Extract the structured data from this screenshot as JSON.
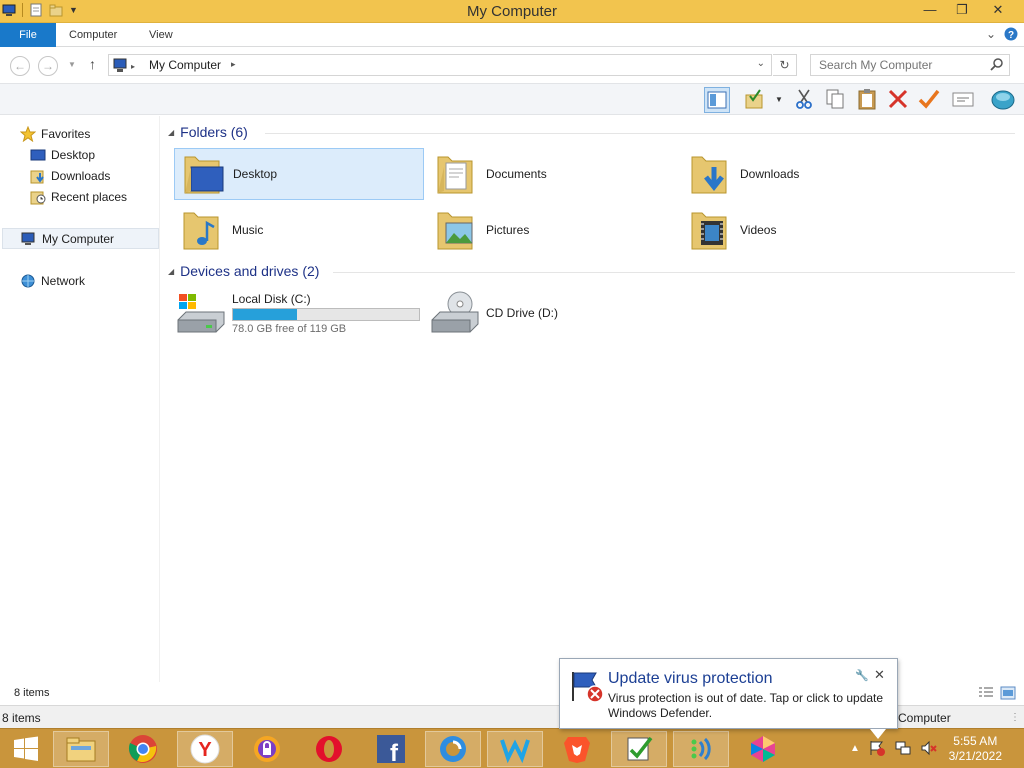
{
  "window": {
    "title": "My Computer"
  },
  "ribbon": {
    "tabs": [
      "File",
      "Computer",
      "View"
    ]
  },
  "address": {
    "path": "My Computer",
    "search_placeholder": "Search My Computer"
  },
  "sidebar": {
    "favorites_label": "Favorites",
    "favorites": [
      "Desktop",
      "Downloads",
      "Recent places"
    ],
    "computer_label": "My Computer",
    "network_label": "Network"
  },
  "folders": {
    "header": "Folders (6)",
    "items": [
      "Desktop",
      "Documents",
      "Downloads",
      "Music",
      "Pictures",
      "Videos"
    ]
  },
  "drives": {
    "header": "Devices and drives (2)",
    "local": {
      "name": "Local Disk (C:)",
      "free_text": "78.0 GB free of 119 GB",
      "used_fraction": 0.345
    },
    "cd": {
      "name": "CD Drive (D:)"
    }
  },
  "status": {
    "items_top": "8 items",
    "items_bottom": "8 items",
    "location": "Computer"
  },
  "notification": {
    "title": "Update virus protection",
    "body": "Virus protection is out of date. Tap or click to update Windows Defender."
  },
  "clock": {
    "time": "5:55 AM",
    "date": "3/21/2022"
  },
  "colors": {
    "titlebar": "#f2c44e",
    "file_tab": "#1979ca",
    "taskbar": "#c9953c",
    "progress": "#26a0da"
  }
}
